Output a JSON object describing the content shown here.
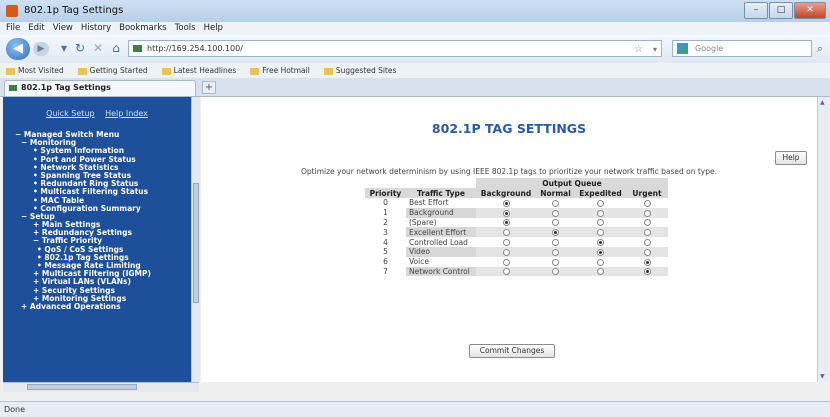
{
  "window": {
    "title": "802.1p Tag Settings"
  },
  "menu": [
    "File",
    "Edit",
    "View",
    "History",
    "Bookmarks",
    "Tools",
    "Help"
  ],
  "address": {
    "url": "http://169.254.100.100/"
  },
  "search": {
    "placeholder": "Google"
  },
  "bookmarks": [
    "Most Visited",
    "Getting Started",
    "Latest Headlines",
    "Free Hotmail",
    "Suggested Sites"
  ],
  "tab": {
    "label": "802.1p Tag Settings"
  },
  "sidebar": {
    "links": [
      "Quick Setup",
      "Help Index"
    ],
    "tree": [
      {
        "text": "Managed Switch Menu",
        "level": 0,
        "prefix": "−"
      },
      {
        "text": "Monitoring",
        "level": 1,
        "prefix": "−"
      },
      {
        "text": "System Information",
        "level": 2,
        "prefix": "•"
      },
      {
        "text": "Port and Power Status",
        "level": 2,
        "prefix": "•"
      },
      {
        "text": "Network Statistics",
        "level": 2,
        "prefix": "•"
      },
      {
        "text": "Spanning Tree Status",
        "level": 2,
        "prefix": "•"
      },
      {
        "text": "Redundant Ring Status",
        "level": 2,
        "prefix": "•"
      },
      {
        "text": "Multicast Filtering Status",
        "level": 2,
        "prefix": "•"
      },
      {
        "text": "MAC Table",
        "level": 2,
        "prefix": "•"
      },
      {
        "text": "Configuration Summary",
        "level": 2,
        "prefix": "•"
      },
      {
        "text": "Setup",
        "level": 1,
        "prefix": "−"
      },
      {
        "text": "Main Settings",
        "level": 2,
        "prefix": "+"
      },
      {
        "text": "Redundancy Settings",
        "level": 2,
        "prefix": "+"
      },
      {
        "text": "Traffic Priority",
        "level": 2,
        "prefix": "−"
      },
      {
        "text": "QoS / CoS Settings",
        "level": 3,
        "prefix": "•"
      },
      {
        "text": "802.1p Tag Settings",
        "level": 3,
        "prefix": "•"
      },
      {
        "text": "Message Rate Limiting",
        "level": 3,
        "prefix": "•"
      },
      {
        "text": "Multicast Filtering (IGMP)",
        "level": 2,
        "prefix": "+"
      },
      {
        "text": "Virtual LANs (VLANs)",
        "level": 2,
        "prefix": "+"
      },
      {
        "text": "Security Settings",
        "level": 2,
        "prefix": "+"
      },
      {
        "text": "Monitoring Settings",
        "level": 2,
        "prefix": "+"
      },
      {
        "text": "Advanced Operations",
        "level": 1,
        "prefix": "+"
      }
    ]
  },
  "page": {
    "title": "802.1P TAG SETTINGS",
    "help_label": "Help",
    "description": "Optimize your network determinism by using IEEE 802.1p tags to prioritize your network traffic based on type.",
    "group_header": "Output Queue",
    "headers": {
      "priority": "Priority",
      "type": "Traffic Type",
      "q0": "Background",
      "q1": "Normal",
      "q2": "Expedited",
      "q3": "Urgent"
    },
    "rows": [
      {
        "priority": "0",
        "type": "Best Effort",
        "selected": 0
      },
      {
        "priority": "1",
        "type": "Background",
        "selected": 0
      },
      {
        "priority": "2",
        "type": "(Spare)",
        "selected": 0
      },
      {
        "priority": "3",
        "type": "Excellent Effort",
        "selected": 1
      },
      {
        "priority": "4",
        "type": "Controlled Load",
        "selected": 2
      },
      {
        "priority": "5",
        "type": "Video",
        "selected": 2
      },
      {
        "priority": "6",
        "type": "Voice",
        "selected": 3
      },
      {
        "priority": "7",
        "type": "Network Control",
        "selected": 3
      }
    ],
    "commit_label": "Commit Changes"
  },
  "status": {
    "text": "Done"
  }
}
